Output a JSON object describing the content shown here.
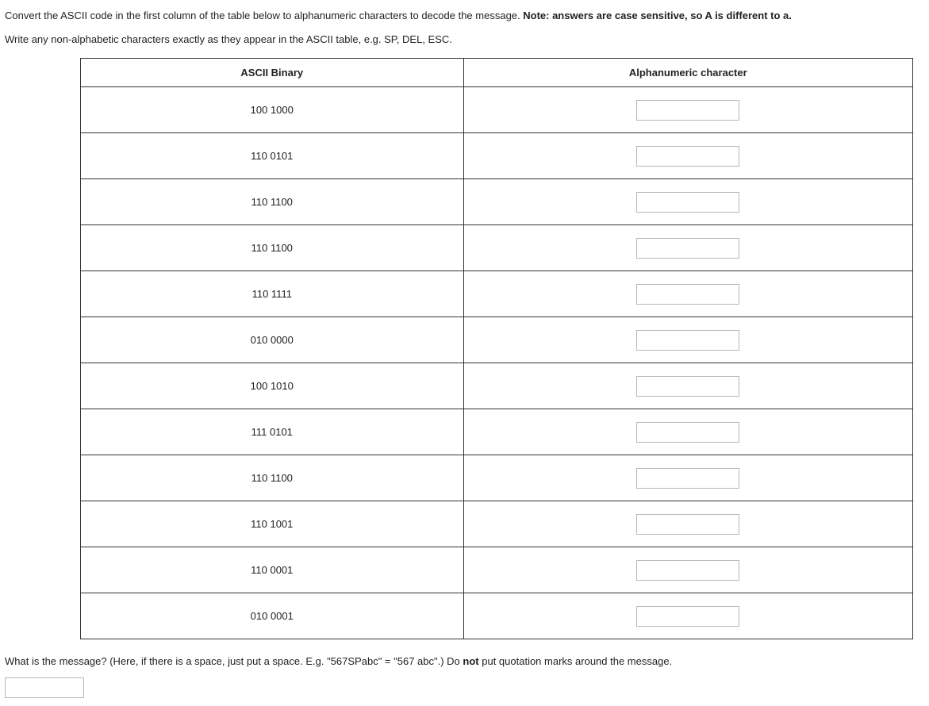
{
  "instructions": {
    "line1_pre": "Convert the ASCII code in the first column of the table below to alphanumeric characters to decode the message. ",
    "line1_bold": "Note: answers are case sensitive, so A is different to a.",
    "line2": "Write any non-alphabetic characters exactly as they appear in the ASCII table, e.g. SP, DEL, ESC."
  },
  "table": {
    "headers": [
      "ASCII Binary",
      "Alphanumeric character"
    ],
    "rows": [
      {
        "binary": "100 1000"
      },
      {
        "binary": "110 0101"
      },
      {
        "binary": "110 1100"
      },
      {
        "binary": "110 1100"
      },
      {
        "binary": "110 1111"
      },
      {
        "binary": "010 0000"
      },
      {
        "binary": "100 1010"
      },
      {
        "binary": "111 0101"
      },
      {
        "binary": "110 1100"
      },
      {
        "binary": "110 1001"
      },
      {
        "binary": "110 0001"
      },
      {
        "binary": "010 0001"
      }
    ]
  },
  "message_question": {
    "pre": "What is the message? (Here, if there is a space, just put a space. E.g. \"567SPabc\" = \"567 abc\".) Do ",
    "bold": "not",
    "post": " put quotation marks around the message."
  }
}
